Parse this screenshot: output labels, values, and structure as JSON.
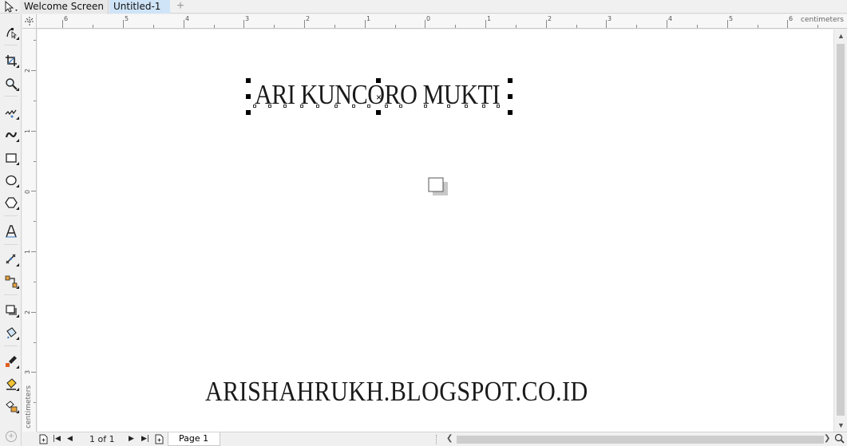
{
  "tabs": {
    "welcome_label": "Welcome Screen",
    "active_label": "Untitled-1",
    "add_label": "+"
  },
  "rulers": {
    "unit": "centimeters",
    "h_labels": [
      "6",
      "5",
      "4",
      "3",
      "2",
      "1",
      "0",
      "1",
      "2",
      "3",
      "4",
      "5",
      "6"
    ],
    "v_labels": [
      "2",
      "1",
      "0",
      "1",
      "2",
      "3"
    ]
  },
  "canvas": {
    "selected_text": "ARI KUNCORO MUKTI",
    "footer_text": "ARISHAHRUKH.BLOGSPOT.CO.ID"
  },
  "status": {
    "page_counter": "1 of 1",
    "page_tab_label": "Page 1"
  },
  "tools": [
    "pick-tool-icon",
    "shape-tool-icon",
    "crop-tool-icon",
    "zoom-tool-icon",
    "freehand-tool-icon",
    "artistic-media-icon",
    "rectangle-tool-icon",
    "ellipse-tool-icon",
    "polygon-tool-icon",
    "text-tool-icon",
    "parallel-dimension-icon",
    "connector-tool-icon",
    "drop-shadow-icon",
    "transparency-icon",
    "color-eyedropper-icon",
    "interactive-fill-icon",
    "smart-fill-icon"
  ],
  "colors": {
    "active_tab": "#cfe4f7",
    "canvas": "#ffffff",
    "chrome": "#f0f0f0"
  }
}
